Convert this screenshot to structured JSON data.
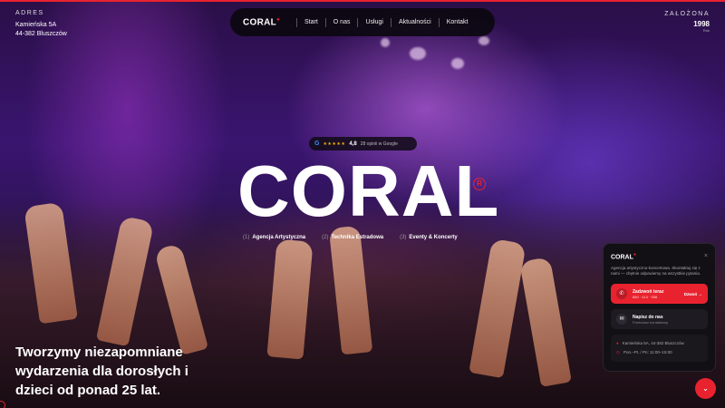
{
  "address": {
    "label": "ADRES",
    "line1": "Kamieńska 5A",
    "line2": "44-382 Bluszczów"
  },
  "founded": {
    "label": "ZAŁOŻONA",
    "year": "1998",
    "since": "Rok"
  },
  "nav": {
    "logo": "CORAL",
    "items": [
      "Start",
      "O nas",
      "Usługi",
      "Aktualności",
      "Kontakt"
    ]
  },
  "rating": {
    "stars": "★★★★★",
    "score": "4,8",
    "reviews": "28 opinii w Google"
  },
  "brand": {
    "name": "CORAL",
    "reg": "R"
  },
  "services": [
    {
      "num": "(1)",
      "name": "Agencja Artystyczna"
    },
    {
      "num": "(2)",
      "name": "Technika Estradowa"
    },
    {
      "num": "(3)",
      "name": "Eventy & Koncerty"
    }
  ],
  "tagline": "Tworzymy niezapomniane wydarzenia dla dorosłych i dzieci od ponad 25 lat.",
  "widget": {
    "logo": "CORAL",
    "close": "×",
    "desc": "Agencja artystyczno-koncertowa. Skontaktuj się z nami — chętnie odpowiemy na wszystkie pytania.",
    "call_title": "Zadzwoń teraz",
    "call_sub": "880 · 414 · 938",
    "call_action": "Dzwoń →",
    "write_title": "Napisz do nas",
    "write_sub": "Formularz kontaktowy",
    "info_address": "Kamieńska 5A, 44-382 Bluszczów",
    "info_hours": "Pon.–Pt. / Pn: 11:00–15:00"
  },
  "fab_icon": "chevron-down-icon",
  "colors": {
    "accent": "#e8232f",
    "dark": "#121014"
  }
}
